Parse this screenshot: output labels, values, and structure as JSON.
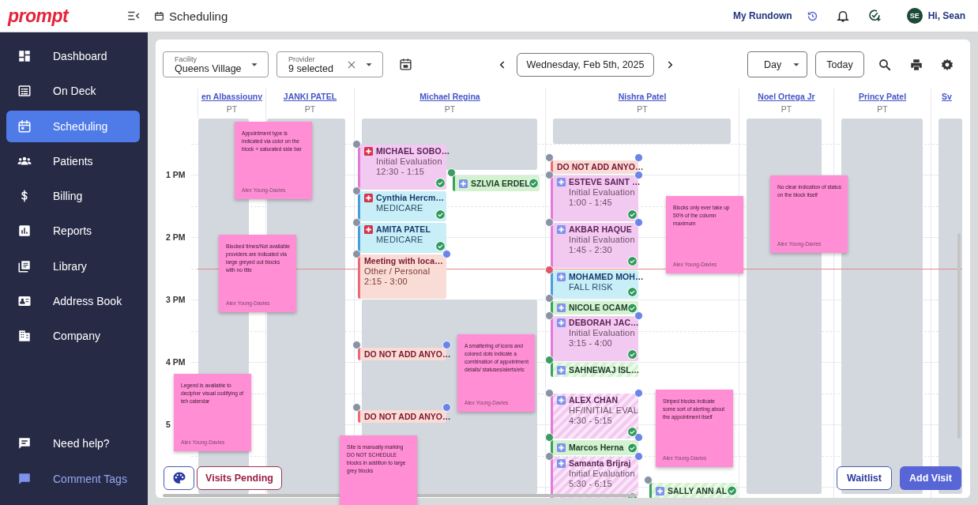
{
  "topbar": {
    "logo": "prompt",
    "title": "Scheduling",
    "link": "My Rundown",
    "avatar": "SE",
    "greeting": "Hi, Sean"
  },
  "sidebar": {
    "items": [
      {
        "label": "Dashboard",
        "selected": false
      },
      {
        "label": "On Deck",
        "selected": false
      },
      {
        "label": "Scheduling",
        "selected": true
      },
      {
        "label": "Patients",
        "selected": false
      },
      {
        "label": "Billing",
        "selected": false
      },
      {
        "label": "Reports",
        "selected": false
      },
      {
        "label": "Library",
        "selected": false
      },
      {
        "label": "Address Book",
        "selected": false
      },
      {
        "label": "Company",
        "selected": false
      }
    ],
    "footer": [
      {
        "label": "Need help?",
        "kind": "help"
      },
      {
        "label": "Comment Tags",
        "kind": "tags"
      }
    ]
  },
  "toolbar": {
    "facility": {
      "label": "Facility",
      "value": "Queens Village"
    },
    "provider": {
      "label": "Provider",
      "value": "9 selected"
    },
    "date": "Wednesday, Feb 5th, 2025",
    "view": "Day",
    "today": "Today"
  },
  "times": [
    "1 PM",
    "2 PM",
    "3 PM",
    "4 PM",
    "5"
  ],
  "providers": [
    {
      "name": "en Albassiouny",
      "role": "PT",
      "blocks": [
        {
          "kind": "unavailable"
        }
      ]
    },
    {
      "name": "JANKI PATEL",
      "role": "PT",
      "blocks": [
        {
          "kind": "unavailable"
        }
      ]
    },
    {
      "name": "Michael Regina",
      "role": "PT",
      "blocks": [
        {
          "kind": "unavailable"
        },
        {
          "kind": "unavailable"
        }
      ],
      "events": [
        {
          "kind": "evaluation",
          "title": "MICHAEL SOBO…",
          "details": [
            "Initial Evaluation",
            "12:30 - 1:15"
          ],
          "badge": {
            "color": "#d6334d"
          },
          "confirmed": true,
          "striped": false,
          "start_dot": {
            "color": "#8a93a5"
          }
        },
        {
          "kind": "checkin",
          "title": "SZLVIA ERDEL",
          "badge": {
            "color": "#7f93ec"
          },
          "confirmed": true,
          "striped": false,
          "start_dot": {
            "color": "#3d9c62"
          }
        },
        {
          "kind": "insurance",
          "title": "Cynthia Hercm…",
          "details": [
            "MEDICARE"
          ],
          "badge": {
            "color": "#d6334d"
          },
          "confirmed": true,
          "striped": false,
          "start_dot": {
            "color": "#8a93a5"
          }
        },
        {
          "kind": "insurance",
          "title": "AMITA PATEL",
          "details": [
            "MEDICARE"
          ],
          "badge": {
            "color": "#d6334d"
          },
          "confirmed": true,
          "striped": false,
          "start_dot": {
            "color": "#8a93a5"
          }
        },
        {
          "kind": "personal",
          "title": "Meeting with loca…",
          "details": [
            "Other / Personal",
            "2:15 - 3:00"
          ],
          "confirmed": false,
          "striped": false,
          "start_dot": {
            "color": "#8a93a5"
          },
          "end_dot": {
            "color": "#6a84e8"
          }
        },
        {
          "kind": "personal",
          "title": "DO NOT ADD ANYO…",
          "confirmed": false,
          "striped": false,
          "start_dot": {
            "color": "#8a93a5"
          },
          "end_dot": {
            "color": "#6a84e8"
          }
        },
        {
          "kind": "personal",
          "title": "DO NOT ADD ANYO…",
          "confirmed": false,
          "striped": false,
          "start_dot": {
            "color": "#8a93a5"
          },
          "end_dot": {
            "color": "#6a84e8"
          }
        }
      ]
    },
    {
      "name": "Nishra Patel",
      "role": "PT",
      "blocks": [
        {
          "kind": "unavailable"
        }
      ],
      "events": [
        {
          "kind": "personal",
          "title": "DO NOT ADD ANYO…",
          "confirmed": false,
          "striped": false,
          "start_dot": {
            "color": "#8a93a5"
          },
          "end_dot": {
            "color": "#6a84e8"
          }
        },
        {
          "kind": "evaluation",
          "title": "ESTEVE SAINT …",
          "details": [
            "Initial Evaluation",
            "1:00 - 1:45"
          ],
          "badge": {
            "color": "#7f93ec"
          },
          "confirmed": true,
          "striped": false,
          "start_dot": {
            "color": "#8a93a5"
          },
          "end_dot": {
            "color": "#6a84e8"
          }
        },
        {
          "kind": "evaluation",
          "title": "AKBAR HAQUE",
          "details": [
            "Initial Evaluation",
            "1:45 - 2:30"
          ],
          "badge": {
            "color": "#7f93ec"
          },
          "confirmed": true,
          "striped": false,
          "start_dot": {
            "color": "#8a93a5"
          },
          "end_dot": {
            "color": "#6a84e8"
          }
        },
        {
          "kind": "insurance",
          "title": "MOHAMED MOH…",
          "details": [
            "FALL RISK"
          ],
          "badge": {
            "color": "#7f93ec"
          },
          "confirmed": true,
          "striped": false,
          "start_dot": {
            "color": "#e0566a"
          }
        },
        {
          "kind": "checkin",
          "title": "NICOLE OCAM",
          "badge": {
            "color": "#7f93ec"
          },
          "confirmed": true,
          "striped": false,
          "start_dot": {
            "color": "#8a93a5"
          }
        },
        {
          "kind": "evaluation",
          "title": "DEBORAH JAC…",
          "details": [
            "Initial Evaluation",
            "3:15 - 4:00"
          ],
          "badge": {
            "color": "#7f93ec"
          },
          "confirmed": true,
          "striped": false,
          "start_dot": {
            "color": "#8a93a5"
          },
          "end_dot": {
            "color": "#6a84e8"
          }
        },
        {
          "kind": "checkin",
          "title": "SAHNEWAJ ISL…",
          "badge": {
            "color": "#7f93ec"
          },
          "confirmed": false,
          "striped": true,
          "start_dot": {
            "color": "#3d9c62"
          }
        },
        {
          "kind": "evaluation",
          "title": "ALEX CHAN",
          "details": [
            "HF/INITIAL EVAL",
            "4:30 - 5:15"
          ],
          "badge": {
            "color": "#7f93ec"
          },
          "confirmed": true,
          "striped": true,
          "start_dot": {
            "color": "#8a93a5"
          },
          "end_dot": {
            "color": "#6a84e8"
          }
        },
        {
          "kind": "checkin",
          "title": "Marcos Herna",
          "badge": {
            "color": "#7f93ec"
          },
          "confirmed": true,
          "striped": false,
          "start_dot": {
            "color": "#3d9c62"
          },
          "end_dot": {
            "color": "#6a84e8"
          }
        },
        {
          "kind": "evaluation",
          "title": "Samanta Brijraj",
          "details": [
            "Initial Evaluation",
            "5:30 - 6:15"
          ],
          "badge": {
            "color": "#7f93ec"
          },
          "confirmed": true,
          "striped": true,
          "start_dot": {
            "color": "#8a93a5"
          },
          "end_dot": {
            "color": "#6a84e8"
          }
        },
        {
          "kind": "checkin",
          "title": "SALLY ANN AL",
          "badge": {
            "color": "#7f93ec"
          },
          "confirmed": true,
          "striped": true,
          "start_dot": {
            "color": "#8a93a5"
          }
        }
      ]
    },
    {
      "name": "Noel Ortega Jr",
      "role": "PT",
      "blocks": [
        {
          "kind": "unavailable"
        }
      ]
    },
    {
      "name": "Princy Patel",
      "role": "PT",
      "blocks": [
        {
          "kind": "unavailable"
        }
      ]
    },
    {
      "name": "Sv",
      "blocks": [
        {
          "kind": "unavailable"
        }
      ]
    }
  ],
  "notes": [
    {
      "text": "Appointment type is indicated via color on the block + saturated side bar",
      "author": "Alex Young-Davies"
    },
    {
      "text": "Blocked times/Not available providers are indicated via large greyed out blocks with no title",
      "author": "Alex Young-Davies"
    },
    {
      "text": "Legend is available to decipher visual codifying of teh calendar",
      "author": "Alex Young-Davies"
    },
    {
      "text": "Site is manually marking DO NOT SCHEDULE blocks in addition to large grey blocks"
    },
    {
      "text": "A smattering of icons and colored dots indicate a combination of appointment details/ statuses/alerts/etc",
      "author": "Alex Young-Davies"
    },
    {
      "text": "Blocks only ever take up 50% of the column maximum",
      "author": "Alex Young-Davies"
    },
    {
      "text": "No clear indication of status on the block itself",
      "author": "Alex Young-Davies"
    },
    {
      "text": "Striped blocks indicate some sort of alerting about the appointment itself",
      "author": "Alex Young-Davies"
    }
  ],
  "footer_buttons": {
    "pending": "Visits Pending",
    "waitlist": "Waitlist",
    "add": "Add Visit"
  }
}
